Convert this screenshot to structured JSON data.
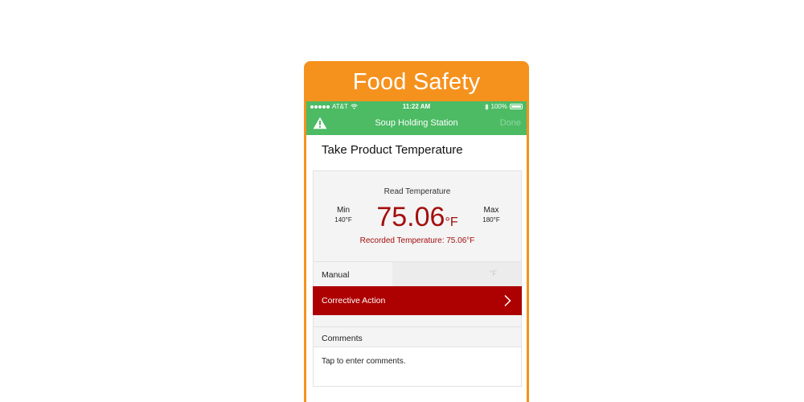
{
  "frame": {
    "title": "Food Safety"
  },
  "status_bar": {
    "carrier": "AT&T",
    "time": "11:22 AM",
    "battery": "100%"
  },
  "nav": {
    "title": "Soup Holding Station",
    "done": "Done",
    "left_icon": "warning-icon"
  },
  "page": {
    "title": "Take Product Temperature"
  },
  "temperature": {
    "read_label": "Read Temperature",
    "min_label": "Min",
    "min_value": "140°F",
    "max_label": "Max",
    "max_value": "180°F",
    "value": "75.06",
    "unit": "°F",
    "recorded": "Recorded Temperature: 75.06°F"
  },
  "manual": {
    "label": "Manual",
    "unit": "°F",
    "value": ""
  },
  "corrective": {
    "label": "Corrective Action"
  },
  "comments": {
    "label": "Comments",
    "placeholder": "Tap to enter comments."
  },
  "colors": {
    "orange": "#f5921e",
    "green": "#4cbb64",
    "red": "#ad0000",
    "temp_red": "#a40e0e"
  }
}
